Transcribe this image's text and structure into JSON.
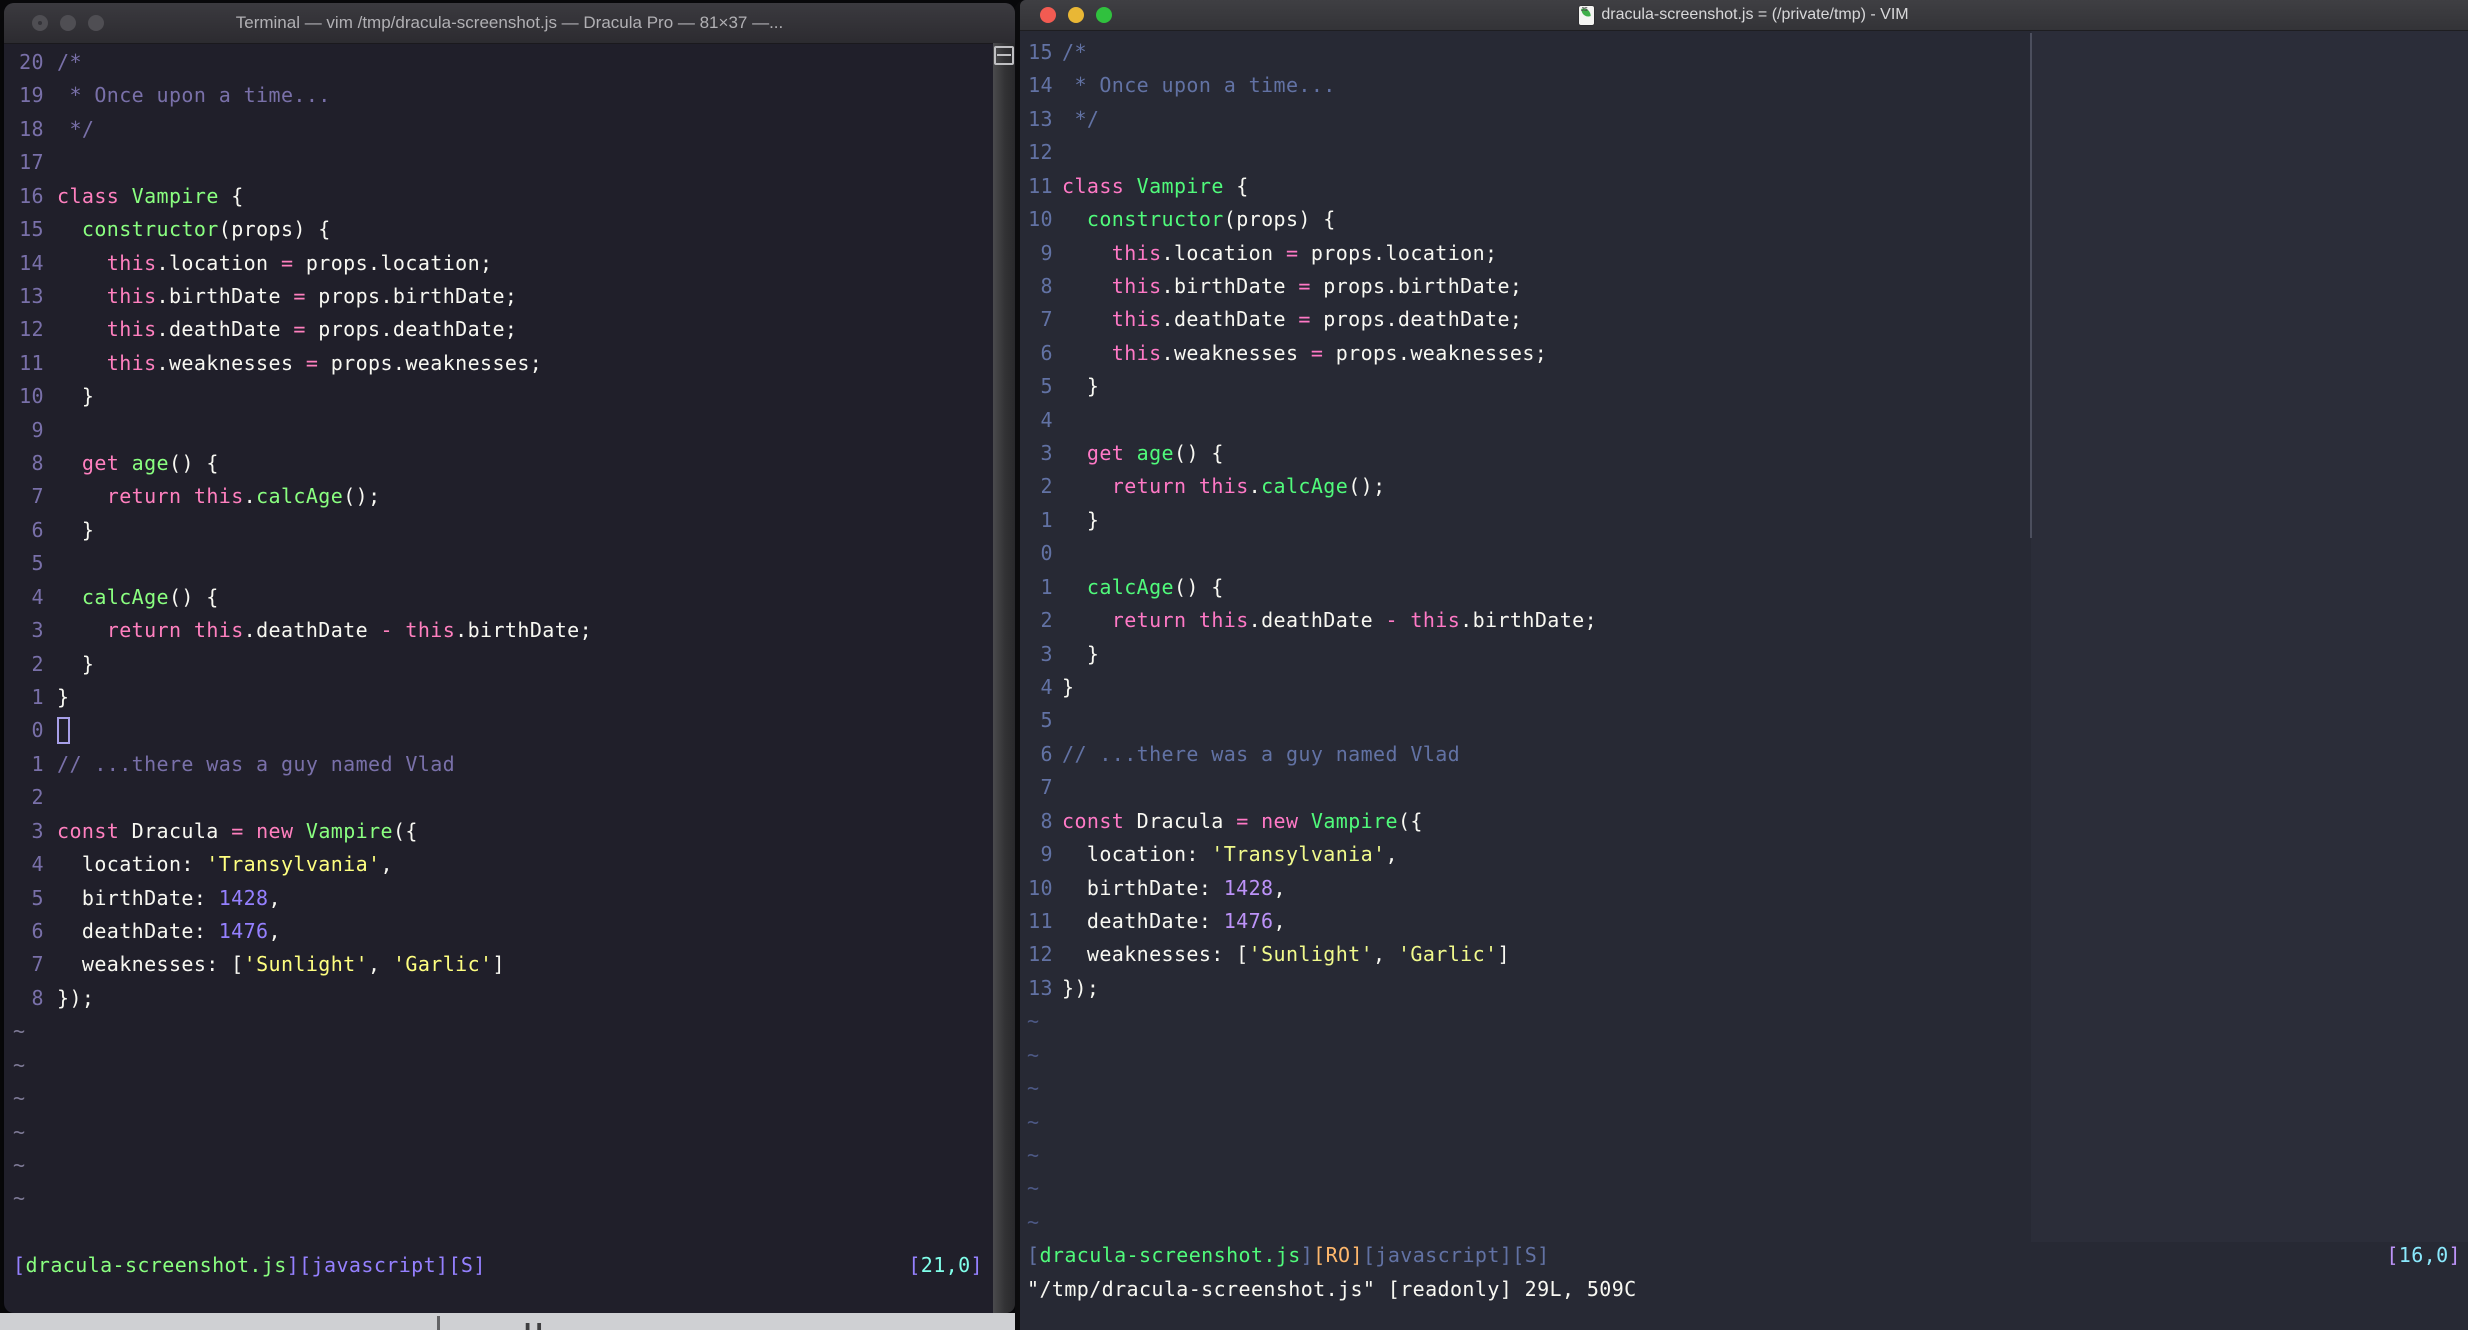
{
  "desktop": {
    "partial_glyphs": "H"
  },
  "left_window": {
    "title": "Terminal — vim /tmp/dracula-screenshot.js — Dracula Pro — 81×37 —...",
    "bg": "#201F2A",
    "traffic_color": "#4f4e53",
    "palette": {
      "c": "#7970A9",
      "k": "#FF80BF",
      "fn": "#8AFF80",
      "s": "#FFFF80",
      "num": "#9580FF",
      "f": "#F8F8F2",
      "ln": "#7970A9",
      "tilde": "#7D7995"
    },
    "cursor_line": 21,
    "hollow_cursor": true,
    "tilde_rows": 6,
    "blank_row_before_status": true,
    "status": [
      [
        "[",
        "#9580FF"
      ],
      [
        "dracula-screenshot.js",
        "#8AFF80"
      ],
      [
        "][",
        "#9580FF"
      ],
      [
        "javascript",
        "#9580FF"
      ],
      [
        "][",
        "#9580FF"
      ],
      [
        "S",
        "#9580FF"
      ],
      [
        "]",
        "#9580FF"
      ]
    ],
    "position": [
      [
        "[",
        "#9580FF"
      ],
      [
        "21,0",
        "#80FFEA"
      ],
      [
        "]",
        "#9580FF"
      ]
    ]
  },
  "right_window": {
    "title": "dracula-screenshot.js = (/private/tmp) - VIM",
    "doc_icon_label": "JS",
    "bg": "#272934",
    "traffic_colors": [
      "#F25B52",
      "#E9B735",
      "#30C13E"
    ],
    "palette": {
      "c": "#6272A4",
      "k": "#FF79C6",
      "fn": "#50FA7B",
      "s": "#F1FA8C",
      "num": "#BD93F9",
      "f": "#F8F8F2",
      "ln": "#6272A4",
      "tilde": "#4C5884"
    },
    "cursor_line": 16,
    "hollow_cursor": false,
    "tilde_rows": 7,
    "status": [
      [
        "[",
        "#6272A4"
      ],
      [
        "dracula-screenshot.js",
        "#50FA7B"
      ],
      [
        "]",
        "#6272A4"
      ],
      [
        "[RO]",
        "#FFB86C"
      ],
      [
        "[",
        "#6272A4"
      ],
      [
        "javascript",
        "#6272A4"
      ],
      [
        "][",
        "#6272A4"
      ],
      [
        "S",
        "#6272A4"
      ],
      [
        "]",
        "#6272A4"
      ]
    ],
    "position": [
      [
        "[",
        "#BD93F9"
      ],
      [
        "16,0",
        "#8BE9FD"
      ],
      [
        "]",
        "#BD93F9"
      ]
    ],
    "command_line": "\"/tmp/dracula-screenshot.js\" [readonly] 29L, 509C"
  },
  "code_lines": [
    [
      [
        "c",
        "/*"
      ]
    ],
    [
      [
        "c",
        " * Once upon a time..."
      ]
    ],
    [
      [
        "c",
        " */"
      ]
    ],
    [],
    [
      [
        "k",
        "class"
      ],
      [
        "f",
        " "
      ],
      [
        "fn",
        "Vampire"
      ],
      [
        "f",
        " {"
      ]
    ],
    [
      [
        "f",
        "  "
      ],
      [
        "fn",
        "constructor"
      ],
      [
        "f",
        "(props) {"
      ]
    ],
    [
      [
        "f",
        "    "
      ],
      [
        "k",
        "this"
      ],
      [
        "f",
        ".location "
      ],
      [
        "k",
        "="
      ],
      [
        "f",
        " props.location;"
      ]
    ],
    [
      [
        "f",
        "    "
      ],
      [
        "k",
        "this"
      ],
      [
        "f",
        ".birthDate "
      ],
      [
        "k",
        "="
      ],
      [
        "f",
        " props.birthDate;"
      ]
    ],
    [
      [
        "f",
        "    "
      ],
      [
        "k",
        "this"
      ],
      [
        "f",
        ".deathDate "
      ],
      [
        "k",
        "="
      ],
      [
        "f",
        " props.deathDate;"
      ]
    ],
    [
      [
        "f",
        "    "
      ],
      [
        "k",
        "this"
      ],
      [
        "f",
        ".weaknesses "
      ],
      [
        "k",
        "="
      ],
      [
        "f",
        " props.weaknesses;"
      ]
    ],
    [
      [
        "f",
        "  }"
      ]
    ],
    [],
    [
      [
        "f",
        "  "
      ],
      [
        "k",
        "get"
      ],
      [
        "f",
        " "
      ],
      [
        "fn",
        "age"
      ],
      [
        "f",
        "() {"
      ]
    ],
    [
      [
        "f",
        "    "
      ],
      [
        "k",
        "return"
      ],
      [
        "f",
        " "
      ],
      [
        "k",
        "this"
      ],
      [
        "f",
        "."
      ],
      [
        "fn",
        "calcAge"
      ],
      [
        "f",
        "();"
      ]
    ],
    [
      [
        "f",
        "  }"
      ]
    ],
    [],
    [
      [
        "f",
        "  "
      ],
      [
        "fn",
        "calcAge"
      ],
      [
        "f",
        "() {"
      ]
    ],
    [
      [
        "f",
        "    "
      ],
      [
        "k",
        "return"
      ],
      [
        "f",
        " "
      ],
      [
        "k",
        "this"
      ],
      [
        "f",
        ".deathDate "
      ],
      [
        "k",
        "-"
      ],
      [
        "f",
        " "
      ],
      [
        "k",
        "this"
      ],
      [
        "f",
        ".birthDate;"
      ]
    ],
    [
      [
        "f",
        "  }"
      ]
    ],
    [
      [
        "f",
        "}"
      ]
    ],
    [],
    [
      [
        "c",
        "// ...there was a guy named Vlad"
      ]
    ],
    [],
    [
      [
        "k",
        "const"
      ],
      [
        "f",
        " Dracula "
      ],
      [
        "k",
        "="
      ],
      [
        "f",
        " "
      ],
      [
        "k",
        "new"
      ],
      [
        "f",
        " "
      ],
      [
        "fn",
        "Vampire"
      ],
      [
        "f",
        "({"
      ]
    ],
    [
      [
        "f",
        "  location: "
      ],
      [
        "s",
        "'Transylvania'"
      ],
      [
        "f",
        ","
      ]
    ],
    [
      [
        "f",
        "  birthDate: "
      ],
      [
        "num",
        "1428"
      ],
      [
        "f",
        ","
      ]
    ],
    [
      [
        "f",
        "  deathDate: "
      ],
      [
        "num",
        "1476"
      ],
      [
        "f",
        ","
      ]
    ],
    [
      [
        "f",
        "  weaknesses: ["
      ],
      [
        "s",
        "'Sunlight'"
      ],
      [
        "f",
        ", "
      ],
      [
        "s",
        "'Garlic'"
      ],
      [
        "f",
        "]"
      ]
    ],
    [
      [
        "f",
        "});"
      ]
    ]
  ]
}
